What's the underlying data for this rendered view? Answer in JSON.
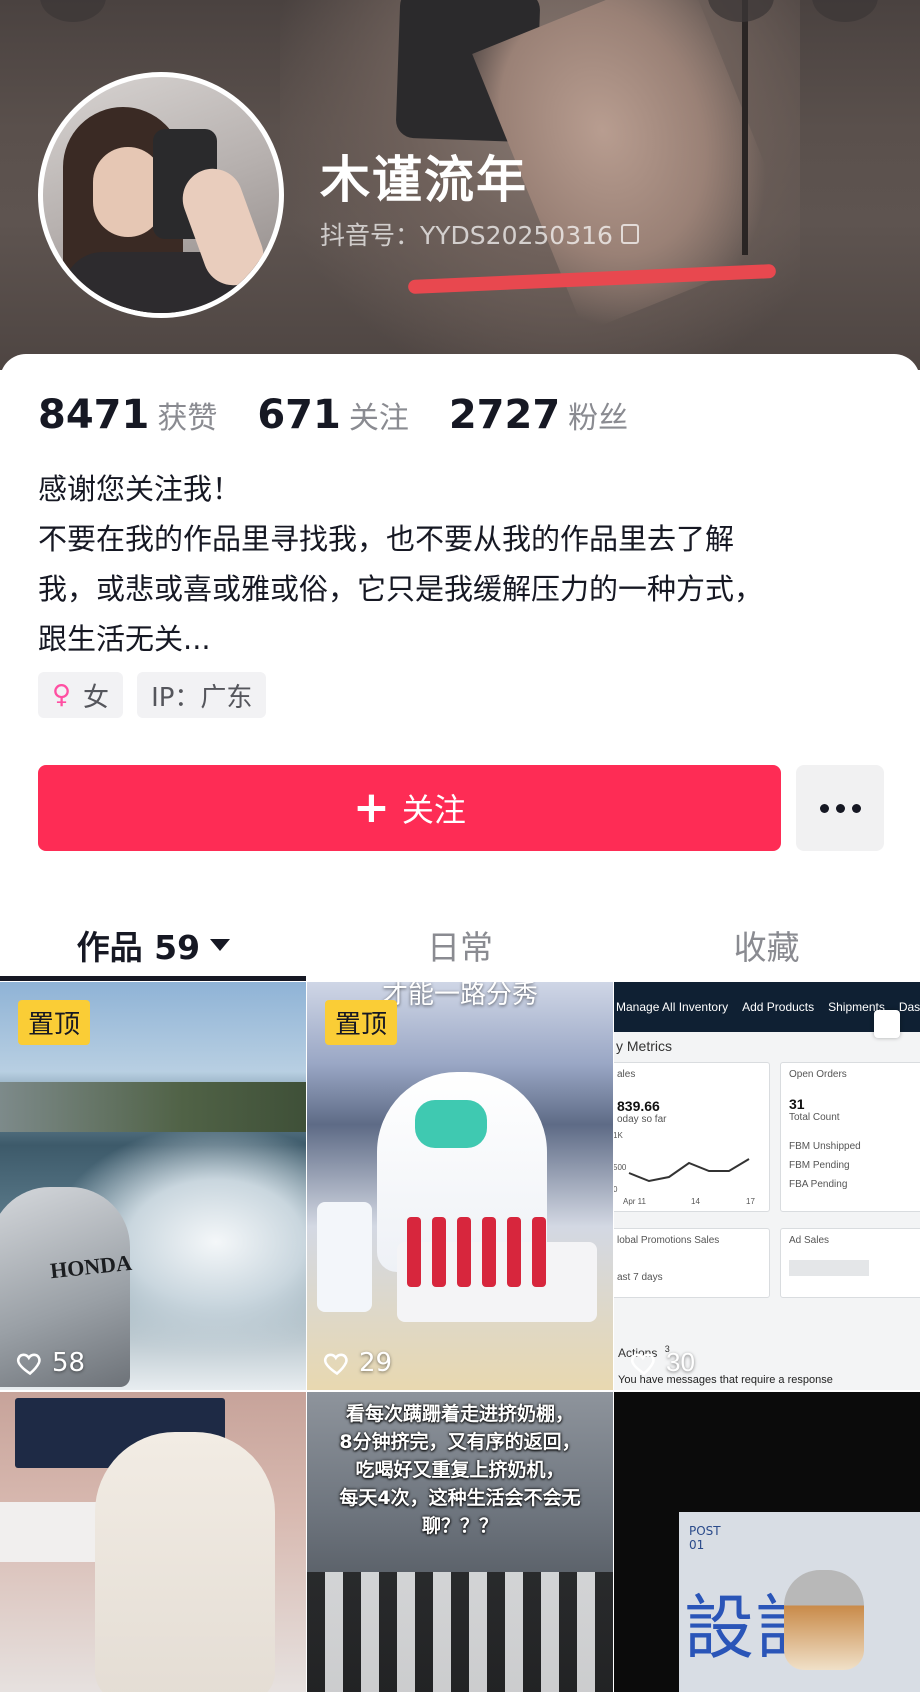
{
  "profile": {
    "nickname": "木谨流年",
    "douyin_id": "抖音号：YYDS20250316"
  },
  "stats": [
    {
      "value": "8471",
      "label": "获赞"
    },
    {
      "value": "671",
      "label": "关注"
    },
    {
      "value": "2727",
      "label": "粉丝"
    }
  ],
  "bio": {
    "line1": "感谢您关注我！",
    "line2": "不要在我的作品里寻找我，也不要从我的作品里去了解",
    "line3": "我，或悲或喜或雅或俗，它只是我缓解压力的一种方式，",
    "line4": "跟生活无关..."
  },
  "tags": {
    "gender": "女",
    "ip": "IP：广东"
  },
  "actions": {
    "follow_label": "关注",
    "accent_color": "#fe2c55"
  },
  "tabs": [
    {
      "label": "作品 59",
      "active": true
    },
    {
      "label": "日常",
      "active": false
    },
    {
      "label": "收藏",
      "active": false
    }
  ],
  "videos": [
    {
      "pinned": "置顶",
      "likes": "58"
    },
    {
      "pinned": "置顶",
      "likes": "29",
      "overlay_text": "才能一路分秀"
    },
    {
      "likes": "30"
    },
    {},
    {
      "caption_lines": [
        "看每次蹒跚着走进挤奶棚，",
        "8分钟挤完，又有序的返回，",
        "吃喝好又重复上挤奶机，",
        "每天4次，这种生活会不会无",
        "聊？？？"
      ]
    },
    {}
  ],
  "dashboard": {
    "nav": [
      "Manage All Inventory",
      "Add Products",
      "Shipments",
      "Dash"
    ],
    "heading": "y Metrics",
    "sales_label": "ales",
    "sales_value": "839.66",
    "sales_sub": "oday so far",
    "orders_label": "Open Orders",
    "orders_value": "31",
    "orders_sub": "Total Count",
    "fbm_unshipped": "FBM Unshipped",
    "fbm_pending": "FBM Pending",
    "fba_pending": "FBA Pending",
    "promo_label": "lobal Promotions Sales",
    "promo_sub": "ast 7 days",
    "ad_label": "Ad Sales",
    "actions_label": "Actions",
    "actions_count": "3",
    "message": "You have messages that require a response",
    "y_ticks": [
      "1K",
      "500",
      "0"
    ],
    "x_ticks": [
      "Apr 11",
      "14",
      "17"
    ]
  },
  "poster": {
    "post_label": "POST",
    "post_num": "01",
    "kanji": "設計"
  },
  "icons": [
    "copy-icon",
    "female-icon",
    "plus-icon",
    "more-icon",
    "caret-down-icon",
    "heart-icon"
  ]
}
